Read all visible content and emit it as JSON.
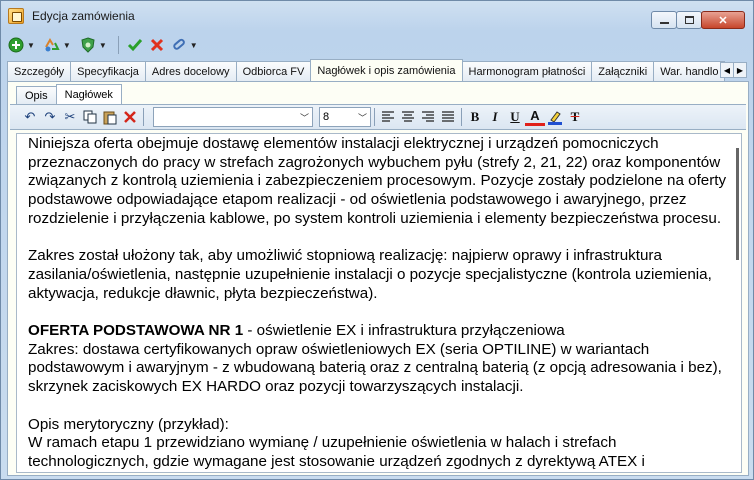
{
  "window": {
    "title": "Edycja zamówienia",
    "close_glyph": "✕"
  },
  "toolbar": {
    "icons": [
      "add-icon",
      "recycle-icon",
      "shield-icon",
      "check-icon",
      "cancel-icon",
      "attach-icon"
    ]
  },
  "main_tabs": [
    {
      "label": "Szczegóły"
    },
    {
      "label": "Specyfikacja"
    },
    {
      "label": "Adres docelowy"
    },
    {
      "label": "Odbiorca FV"
    },
    {
      "label": "Nagłówek i opis zamówienia"
    },
    {
      "label": "Harmonogram płatności"
    },
    {
      "label": "Załączniki"
    },
    {
      "label": "War. handlo"
    }
  ],
  "active_main_tab": "Nagłówek i opis zamówienia",
  "sub_tabs": [
    {
      "label": "Opis"
    },
    {
      "label": "Nagłówek"
    }
  ],
  "active_sub_tab": "Nagłówek",
  "editor_toolbar": {
    "font_name": "",
    "font_size": "8",
    "bold_label": "B",
    "italic_label": "I",
    "underline_label": "U",
    "font_color_label": "A",
    "clear_format_label": "T"
  },
  "content": {
    "p1": "Niniejsza oferta obejmuje dostawę elementów instalacji elektrycznej i urządzeń pomocniczych przeznaczonych do pracy w strefach zagrożonych wybuchem pyłu (strefy 2, 21, 22) oraz komponentów związanych z kontrolą uziemienia i zabezpieczeniem procesowym. Pozycje zostały podzielone na oferty podstawowe odpowiadające etapom realizacji - od oświetlenia podstawowego i awaryjnego, przez rozdzielenie i przyłączenia kablowe, po system kontroli uziemienia i elementy bezpieczeństwa procesu.",
    "p2": "Zakres został ułożony tak, aby umożliwić stopniową realizację: najpierw oprawy i infrastruktura zasilania/oświetlenia, następnie uzupełnienie instalacji o pozycje specjalistyczne (kontrola uziemienia, aktywacja, redukcje dławnic, płyta bezpieczeństwa).",
    "heading_bold": "OFERTA PODSTAWOWA NR 1",
    "heading_rest": " - oświetlenie EX i infrastruktura przyłączeniowa",
    "p3": "Zakres: dostawa certyfikowanych opraw oświetleniowych EX (seria OPTILINE) w wariantach podstawowym i awaryjnym - z wbudowaną baterią oraz z centralną baterią (z opcją adresowania i bez), skrzynek zaciskowych EX HARDO oraz pozycji towarzyszących instalacji.",
    "p4a": "Opis merytoryczny (przykład):",
    "p4b": "W ramach etapu 1 przewidziano wymianę / uzupełnienie oświetlenia w halach i strefach",
    "p4c": "technologicznych, gdzie wymagane jest stosowanie urządzeń zgodnych z dyrektywą ATEX i"
  }
}
